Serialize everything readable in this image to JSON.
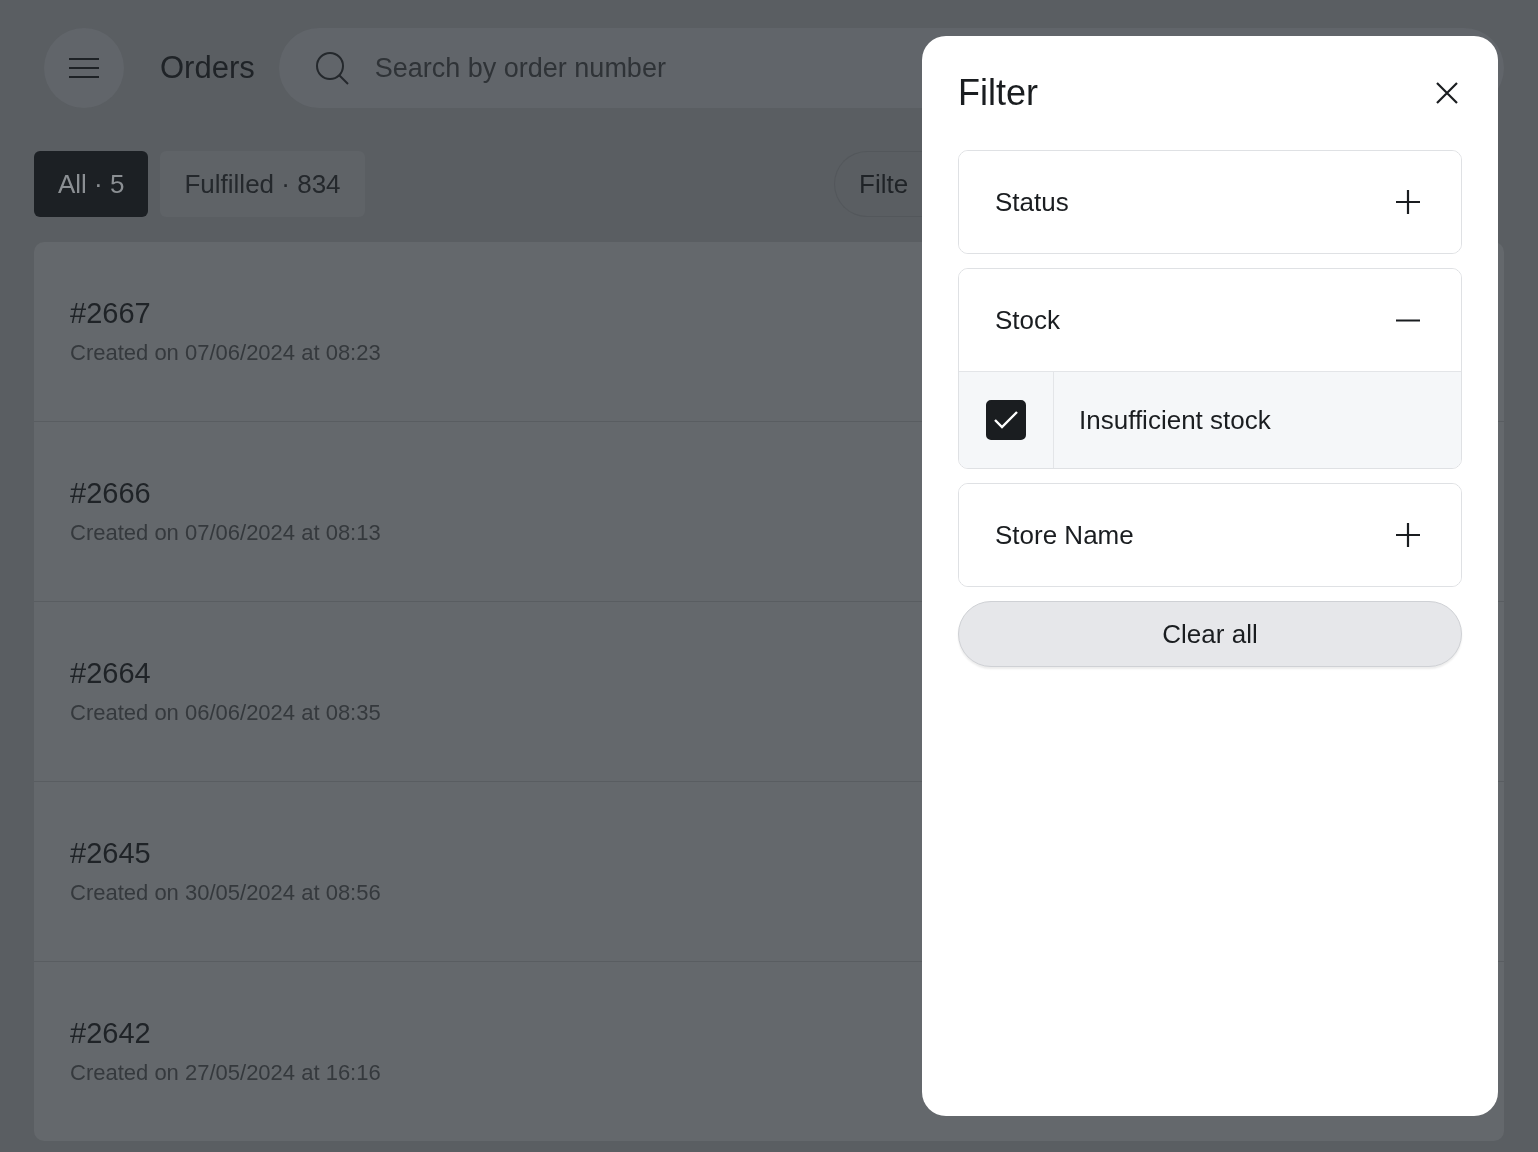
{
  "header": {
    "title": "Orders",
    "search": {
      "placeholder": "Search by order number"
    }
  },
  "tabs": [
    {
      "label": "All · 5",
      "selected": true
    },
    {
      "label": "Fulfilled · 834",
      "selected": false
    }
  ],
  "filter_button": {
    "label": "Filte"
  },
  "orders": [
    {
      "number": "#2667",
      "created": "Created on 07/06/2024 at 08:23"
    },
    {
      "number": "#2666",
      "created": "Created on 07/06/2024 at 08:13"
    },
    {
      "number": "#2664",
      "created": "Created on 06/06/2024 at 08:35"
    },
    {
      "number": "#2645",
      "created": "Created on 30/05/2024 at 08:56"
    },
    {
      "number": "#2642",
      "created": "Created on 27/05/2024 at 16:16"
    }
  ],
  "filter_panel": {
    "title": "Filter",
    "sections": [
      {
        "label": "Status",
        "expanded": false
      },
      {
        "label": "Stock",
        "expanded": true,
        "options": [
          {
            "label": "Insufficient stock",
            "checked": true
          }
        ]
      },
      {
        "label": "Store Name",
        "expanded": false
      }
    ],
    "clear_button": "Clear all"
  }
}
